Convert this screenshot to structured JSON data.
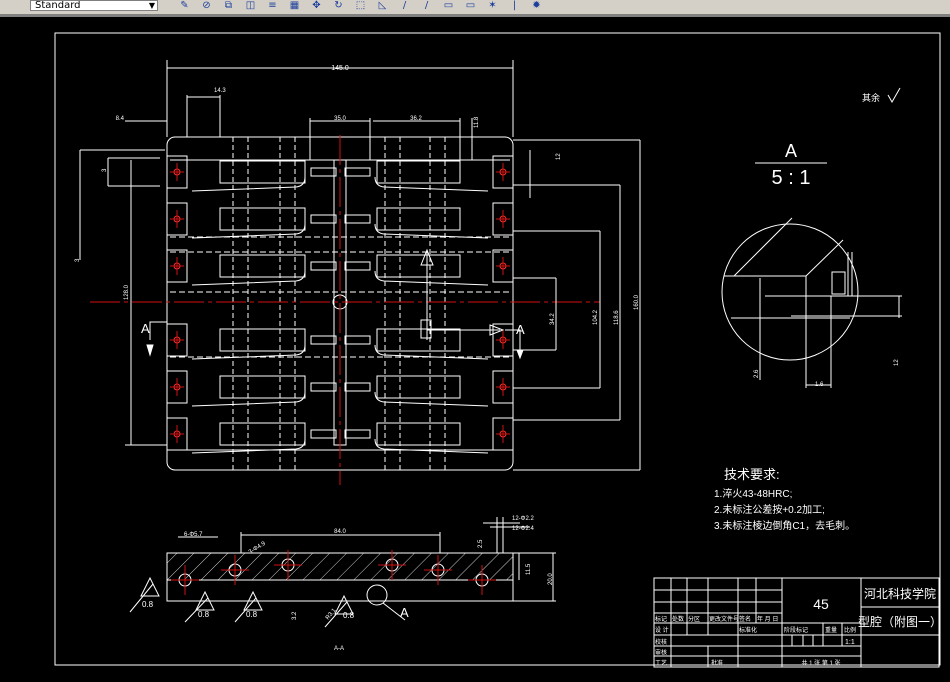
{
  "toolbar": {
    "text_style_value": "Standard",
    "icons": [
      "match-properties-icon",
      "erase-icon",
      "copy-icon",
      "mirror-icon",
      "offset-icon",
      "array-icon",
      "move-icon",
      "rotate-icon",
      "scale-icon",
      "stretch-icon",
      "trim-icon",
      "extend-icon",
      "break-icon",
      "join-icon",
      "chamfer-icon",
      "fillet-icon",
      "explode-icon"
    ]
  },
  "colors": {
    "background": "#000000",
    "lines": "#ffffff",
    "centerlines": "#d01010",
    "toolbar": "#d4d0c8"
  },
  "drawing": {
    "roughness_note": "其余",
    "detail_label": "A",
    "detail_scale": "5 : 1",
    "section_marker": "A",
    "section_title": "A-A",
    "plan_dims": {
      "overall_width": "145.0",
      "top_a": "14.3",
      "left_a": "8.4",
      "center_gap": "35.0",
      "right_a": "36.2",
      "right_b": "11.8",
      "right_small": "12",
      "left_height": "128.0",
      "left_small": "3",
      "right_h1": "34.2",
      "right_h2": "104.2",
      "right_h3": "118.6",
      "overall_height": "160.0"
    },
    "section_dims": {
      "holes": "6-Φ5.7",
      "span": "84.0",
      "bore": "3-Φ4.9",
      "depth": "2.5",
      "h1": "11.5",
      "h2": "20.0",
      "r1": "12-Φ2.2",
      "r2": "12-Φ2.4",
      "step": "3.2",
      "radius": "R3.1"
    },
    "roughness_values": [
      "0.8",
      "0.8",
      "0.8",
      "0.8"
    ],
    "detail_dims": {
      "d1": "2.6",
      "d2": "1.6",
      "d3": "12"
    }
  },
  "tech_requirements": {
    "title": "技术要求:",
    "items": [
      "1.淬火43-48HRC;",
      "2.未标注公差按+0.2加工;",
      "3.未标注棱边倒角C1，去毛刺。"
    ]
  },
  "title_block": {
    "material": "45",
    "school": "河北科技学院",
    "drawing_name": "型腔（附图一）",
    "header_row": [
      "标记",
      "处数",
      "分区",
      "更改文件号",
      "签名",
      "年 月 日"
    ],
    "design_row": [
      "设 计",
      "",
      "",
      "标准化"
    ],
    "rows": [
      "校核",
      "审核",
      "工艺"
    ],
    "approve": "批准",
    "stage_label": "阶段标记",
    "weight_label": "重量",
    "scale_label": "比例",
    "scale_value": "1:1",
    "sheets": "共 1 张  第 1 张"
  }
}
